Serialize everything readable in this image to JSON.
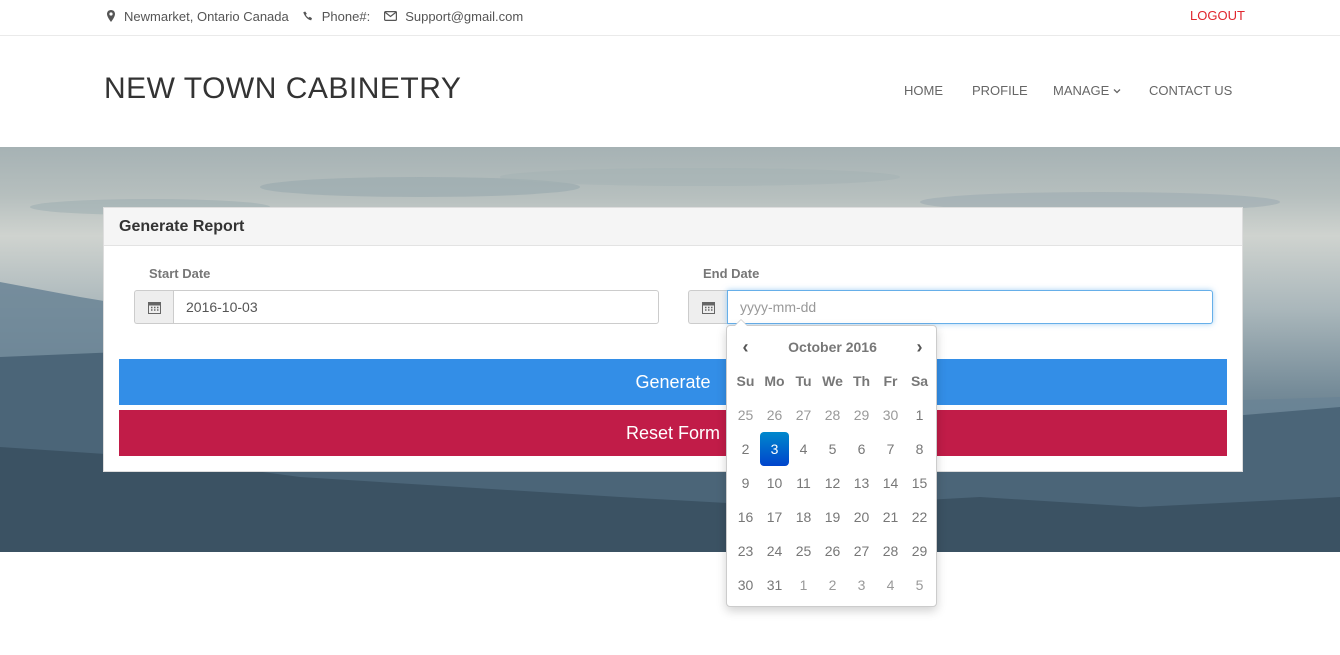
{
  "topbar": {
    "location": "Newmarket, Ontario Canada",
    "phone": "Phone#:",
    "email": "Support@gmail.com",
    "logout": "LOGOUT"
  },
  "header": {
    "brand": "NEW TOWN CABINETRY",
    "nav": [
      "HOME",
      "PROFILE",
      "MANAGE",
      "CONTACT US"
    ]
  },
  "panel": {
    "title": "Generate Report",
    "start_label": "Start Date",
    "start_value": "2016-10-03",
    "end_label": "End Date",
    "end_placeholder": "yyyy-mm-dd",
    "generate_label": "Generate",
    "reset_label": "Reset Form"
  },
  "datepicker": {
    "month_label": "October 2016",
    "prev": "‹",
    "next": "›",
    "weekdays": [
      "Su",
      "Mo",
      "Tu",
      "We",
      "Th",
      "Fr",
      "Sa"
    ],
    "weeks": [
      [
        "25",
        "26",
        "27",
        "28",
        "29",
        "30",
        "1"
      ],
      [
        "2",
        "3",
        "4",
        "5",
        "6",
        "7",
        "8"
      ],
      [
        "9",
        "10",
        "11",
        "12",
        "13",
        "14",
        "15"
      ],
      [
        "16",
        "17",
        "18",
        "19",
        "20",
        "21",
        "22"
      ],
      [
        "23",
        "24",
        "25",
        "26",
        "27",
        "28",
        "29"
      ],
      [
        "30",
        "31",
        "1",
        "2",
        "3",
        "4",
        "5"
      ]
    ],
    "selected_day": "3"
  },
  "colors": {
    "accent_blue": "#338ee7",
    "accent_red": "#c11c48",
    "logout_red": "#e0262e",
    "picker_active": "#0055cc"
  },
  "icons": {
    "location": "map-marker-icon",
    "phone": "phone-icon",
    "email": "envelope-icon",
    "calendar": "calendar-icon",
    "dropdown": "chevron-down-icon"
  }
}
